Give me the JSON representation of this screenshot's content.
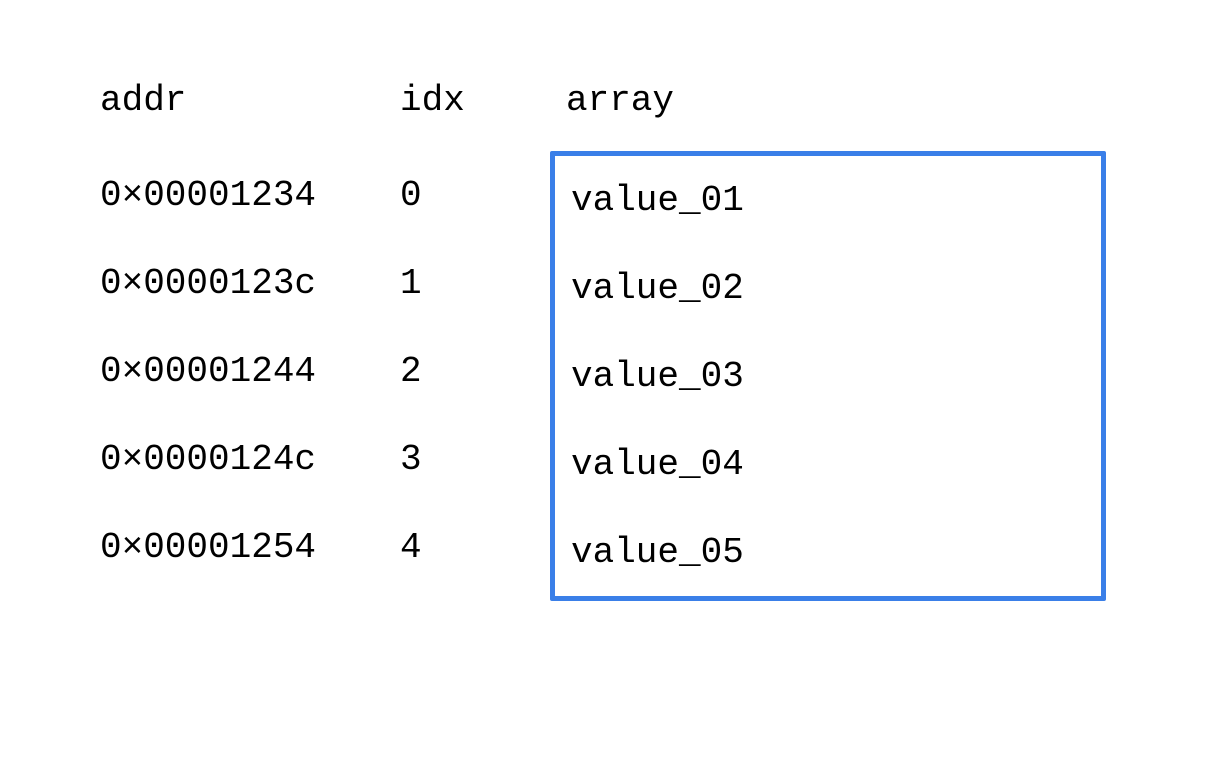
{
  "headers": {
    "addr": "addr",
    "idx": "idx",
    "array": "array"
  },
  "rows": [
    {
      "addr": "0×00001234",
      "idx": "0",
      "value": "value_01"
    },
    {
      "addr": "0×0000123c",
      "idx": "1",
      "value": "value_02"
    },
    {
      "addr": "0×00001244",
      "idx": "2",
      "value": "value_03"
    },
    {
      "addr": "0×0000124c",
      "idx": "3",
      "value": "value_04"
    },
    {
      "addr": "0×00001254",
      "idx": "4",
      "value": "value_05"
    }
  ],
  "colors": {
    "border": "#3A7FE8"
  }
}
